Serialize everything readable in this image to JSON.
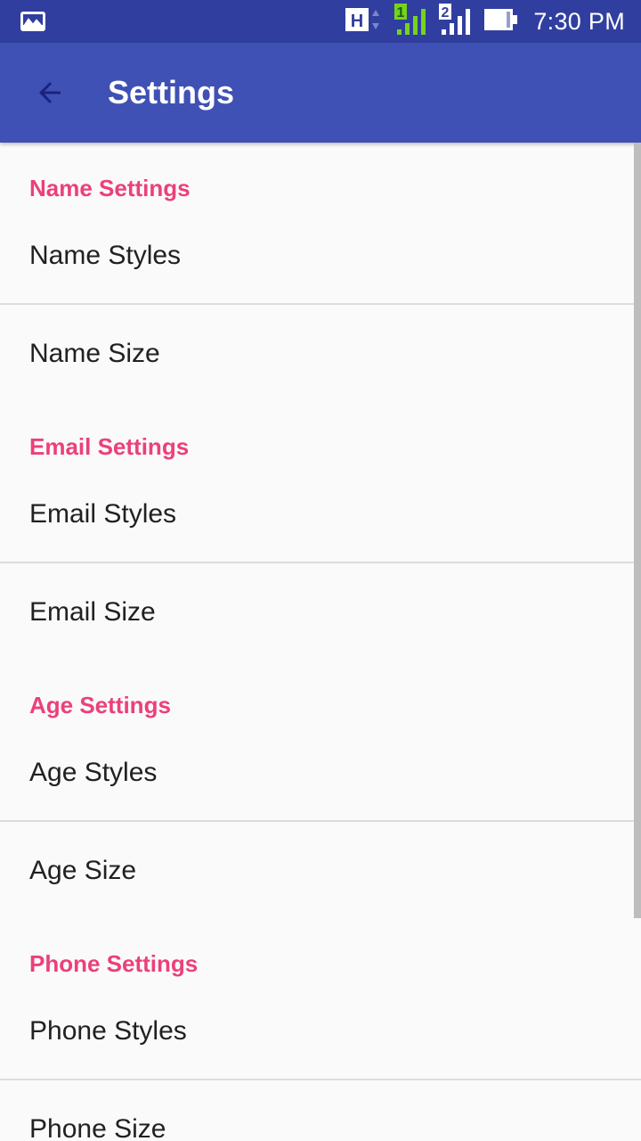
{
  "status_bar": {
    "time": "7:30 PM",
    "network_label": "H",
    "sim1_label": "1",
    "sim2_label": "2",
    "icons": [
      "gallery-notification-icon",
      "network-type-icon",
      "sim1-signal-icon",
      "sim2-signal-icon",
      "battery-icon"
    ]
  },
  "app_bar": {
    "title": "Settings",
    "back_icon": "arrow-back-icon"
  },
  "categories": [
    {
      "title": "Name Settings",
      "items": [
        "Name Styles",
        "Name Size"
      ]
    },
    {
      "title": "Email Settings",
      "items": [
        "Email Styles",
        "Email Size"
      ]
    },
    {
      "title": "Age Settings",
      "items": [
        "Age Styles",
        "Age Size"
      ]
    },
    {
      "title": "Phone Settings",
      "items": [
        "Phone Styles",
        "Phone Size"
      ]
    }
  ],
  "colors": {
    "status_bar": "#303f9f",
    "app_bar": "#3f51b5",
    "category_accent": "#ec407a",
    "item_text": "#212121",
    "background": "#fafafa"
  }
}
